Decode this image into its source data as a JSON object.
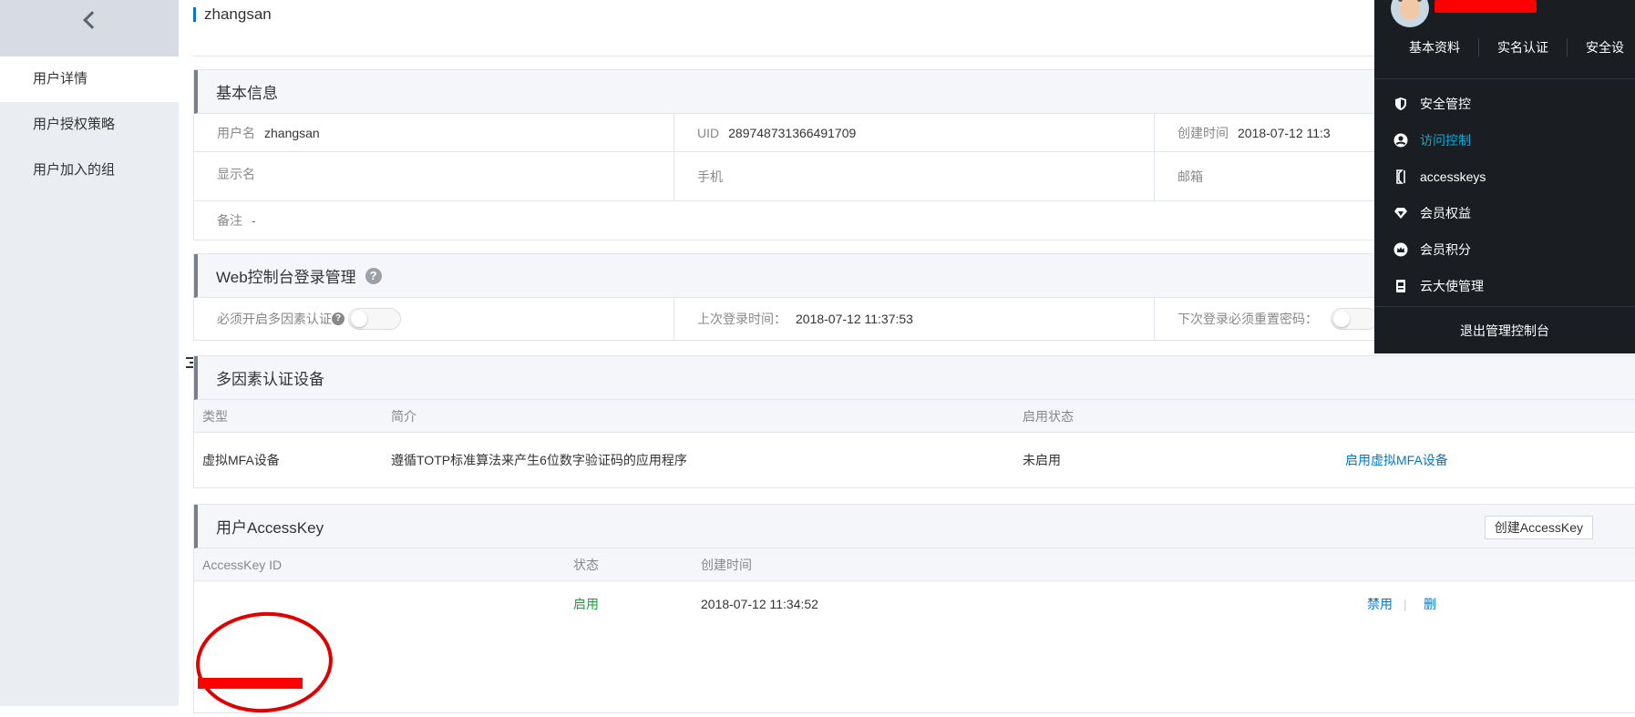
{
  "sidebar": {
    "items": [
      {
        "label": "用户详情",
        "active": true
      },
      {
        "label": "用户授权策略"
      },
      {
        "label": "用户加入的组"
      }
    ]
  },
  "page": {
    "title": "zhangsan"
  },
  "basic_info": {
    "heading": "基本信息",
    "username_label": "用户名",
    "username": "zhangsan",
    "uid_label": "UID",
    "uid": "289748731366491709",
    "created_label": "创建时间",
    "created": "2018-07-12 11:3",
    "display_name_label": "显示名",
    "phone_label": "手机",
    "email_label": "邮箱",
    "note_label": "备注",
    "note": "-"
  },
  "web_login": {
    "heading": "Web控制台登录管理",
    "mfa_required_label": "必须开启多因素认证",
    "mfa_help": "?",
    "heading_help": "?",
    "last_login_label": "上次登录时间：",
    "last_login": "2018-07-12 11:37:53",
    "reset_pwd_label": "下次登录必须重置密码："
  },
  "mfa": {
    "heading": "多因素认证设备",
    "columns": [
      "类型",
      "简介",
      "启用状态"
    ],
    "row": {
      "type": "虚拟MFA设备",
      "desc": "遵循TOTP标准算法来产生6位数字验证码的应用程序",
      "status": "未启用",
      "action": "启用虚拟MFA设备"
    }
  },
  "accesskey": {
    "heading": "用户AccessKey",
    "create_button": "创建AccessKey",
    "columns": [
      "AccessKey ID",
      "状态",
      "创建时间"
    ],
    "row": {
      "status": "启用",
      "created": "2018-07-12 11:34:52",
      "disable": "禁用",
      "sep": "|",
      "delete": "删"
    }
  },
  "dropdown": {
    "tabs": [
      "基本资料",
      "实名认证",
      "安全设"
    ],
    "menu": [
      {
        "label": "安全管控",
        "icon": "shield-icon"
      },
      {
        "label": "访问控制",
        "icon": "user-circle-icon",
        "active": true
      },
      {
        "label": "accesskeys",
        "icon": "key-bracket-icon"
      },
      {
        "label": "会员权益",
        "icon": "diamond-icon"
      },
      {
        "label": "会员积分",
        "icon": "crown-icon"
      },
      {
        "label": "云大使管理",
        "icon": "badge-icon"
      }
    ],
    "logout": "退出管理控制台"
  },
  "colors": {
    "link": "#0077cc",
    "accent_active": "#00b0e0",
    "status_green": "#1e9e3a",
    "annotation_red": "#ff0000"
  }
}
